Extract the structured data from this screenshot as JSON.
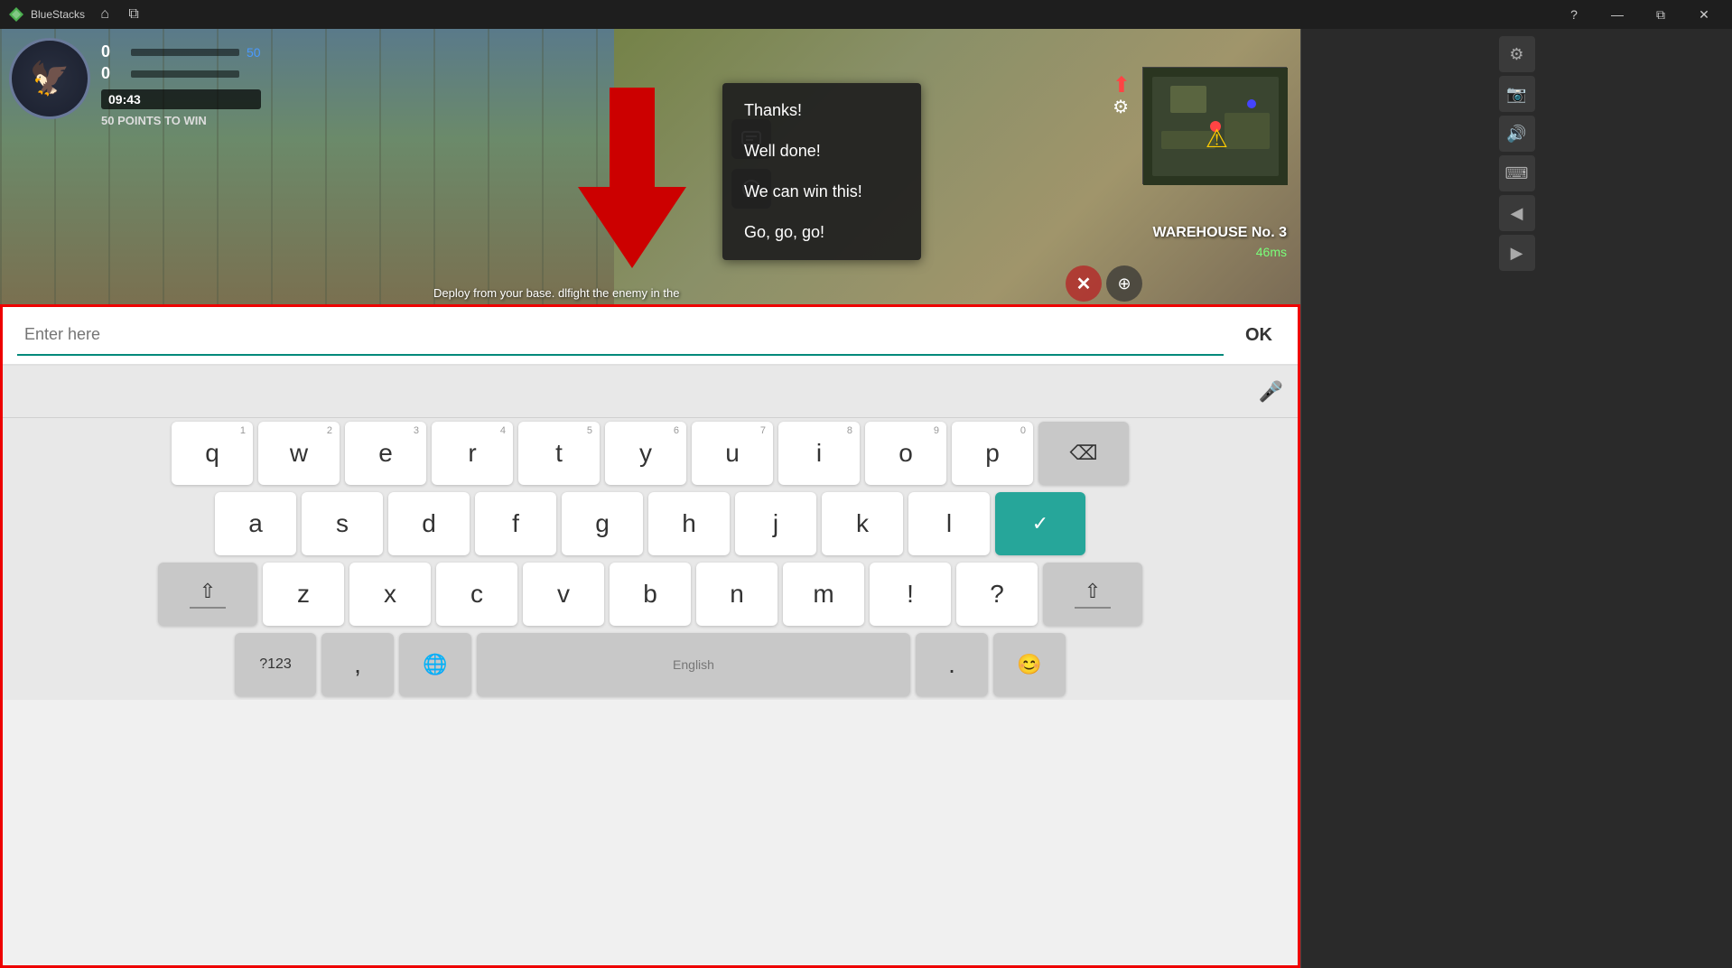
{
  "titlebar": {
    "app_name": "BlueStacks",
    "icon_alt": "bluestacks-logo"
  },
  "game": {
    "score_blue": "0",
    "score_red": "0",
    "score_target": "50",
    "points_label": "50 POINTS TO WIN",
    "timer": "09:43",
    "map_name": "WAREHOUSE No. 3",
    "latency": "46ms",
    "deploy_text": "Deploy from your base. dlfight the enemy in the"
  },
  "chat_menu": {
    "options": [
      "Thanks!",
      "Well done!",
      "We can win this!",
      "Go, go, go!"
    ]
  },
  "keyboard": {
    "input_placeholder": "Enter here",
    "ok_label": "OK",
    "rows": [
      [
        "q",
        "w",
        "e",
        "r",
        "t",
        "y",
        "u",
        "i",
        "o",
        "p"
      ],
      [
        "a",
        "s",
        "d",
        "f",
        "g",
        "h",
        "j",
        "k",
        "l"
      ],
      [
        "z",
        "x",
        "c",
        "v",
        "b",
        "n",
        "m",
        "!",
        "?"
      ]
    ],
    "num_hints": [
      "1",
      "2",
      "3",
      "4",
      "5",
      "6",
      "7",
      "8",
      "9",
      "0"
    ],
    "special_keys": {
      "backspace": "⌫",
      "enter_check": "✓",
      "shift": "⇧",
      "num_switch": "?123",
      "globe": "🌐",
      "space_label": "English",
      "emoji": "😊",
      "comma": ",",
      "period": "."
    }
  }
}
